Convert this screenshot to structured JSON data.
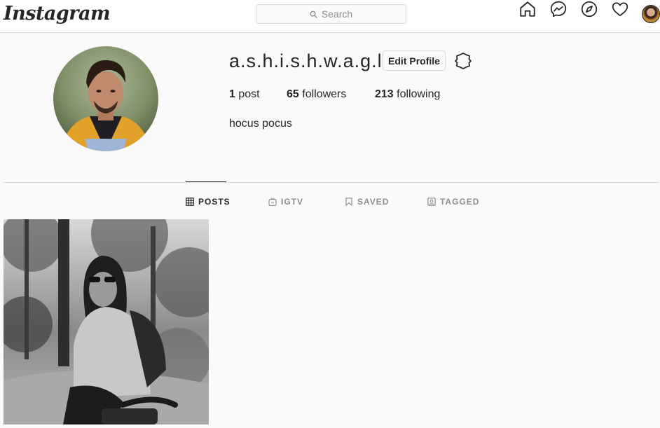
{
  "nav": {
    "logo": "Instagram",
    "search_placeholder": "Search",
    "icons": [
      "home-icon",
      "messenger-icon",
      "explore-icon",
      "activity-heart-icon",
      "profile-avatar"
    ]
  },
  "profile": {
    "username": "a.s.h.i.s.h.w.a.g.l.e",
    "edit_label": "Edit Profile",
    "stats": {
      "posts_count": "1",
      "posts_label": " post",
      "followers_count": "65",
      "followers_label": " followers",
      "following_count": "213",
      "following_label": " following"
    },
    "bio": "hocus pocus"
  },
  "tabs": [
    {
      "label": "POSTS",
      "icon": "grid-icon",
      "active": true
    },
    {
      "label": "IGTV",
      "icon": "igtv-icon",
      "active": false
    },
    {
      "label": "SAVED",
      "icon": "bookmark-icon",
      "active": false
    },
    {
      "label": "TAGGED",
      "icon": "tagged-icon",
      "active": false
    }
  ],
  "colors": {
    "border": "#dbdbdb",
    "text": "#262626",
    "muted": "#8e8e8e",
    "background": "#fafafa"
  }
}
